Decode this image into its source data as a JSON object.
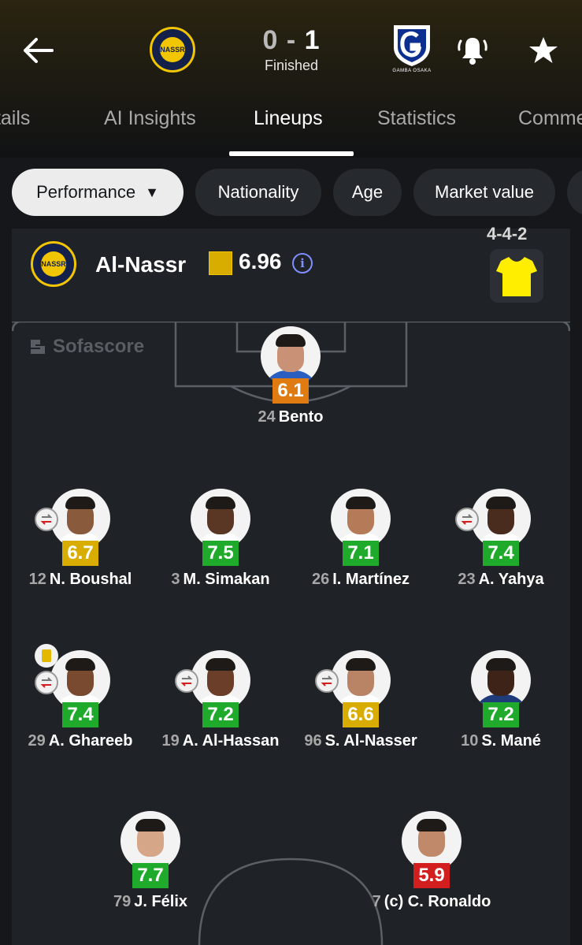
{
  "header": {
    "score_home": "0",
    "score_sep": "-",
    "score_away": "1",
    "status": "Finished",
    "home_logo_text": "NASSR",
    "away_logo_text": "GAMBA OSAKA"
  },
  "tabs": [
    {
      "label": "Details"
    },
    {
      "label": "AI Insights"
    },
    {
      "label": "Lineups",
      "active": true
    },
    {
      "label": "Statistics"
    },
    {
      "label": "Comments"
    }
  ],
  "filters": [
    {
      "label": "Performance",
      "active": true
    },
    {
      "label": "Nationality"
    },
    {
      "label": "Age"
    },
    {
      "label": "Market value"
    }
  ],
  "team": {
    "name": "Al-Nassr",
    "rating": "6.96",
    "formation": "4-4-2",
    "kit_color": "#ffee00"
  },
  "watermark": "Sofascore",
  "colors": {
    "rating_orange": "#e07b12",
    "rating_yellow": "#d8ad00",
    "rating_green": "#1faa2c",
    "rating_red": "#d21e1e"
  },
  "players": [
    {
      "number": "24",
      "name": "Bento",
      "rating": "6.1",
      "rating_color": "orange"
    },
    {
      "number": "12",
      "name": "N. Boushal",
      "rating": "6.7",
      "rating_color": "yellow",
      "sub": true
    },
    {
      "number": "3",
      "name": "M. Simakan",
      "rating": "7.5",
      "rating_color": "green"
    },
    {
      "number": "26",
      "name": "I. Martínez",
      "rating": "7.1",
      "rating_color": "green"
    },
    {
      "number": "23",
      "name": "A. Yahya",
      "rating": "7.4",
      "rating_color": "green",
      "sub": true
    },
    {
      "number": "29",
      "name": "A. Ghareeb",
      "rating": "7.4",
      "rating_color": "green",
      "sub": true,
      "yellow_card": true
    },
    {
      "number": "19",
      "name": "A. Al-Hassan",
      "rating": "7.2",
      "rating_color": "green",
      "sub": true
    },
    {
      "number": "96",
      "name": "S. Al-Nasser",
      "rating": "6.6",
      "rating_color": "yellow",
      "sub": true
    },
    {
      "number": "10",
      "name": "S. Mané",
      "rating": "7.2",
      "rating_color": "green"
    },
    {
      "number": "79",
      "name": "J. Félix",
      "rating": "7.7",
      "rating_color": "green"
    },
    {
      "number": "7",
      "name": "(c) C. Ronaldo",
      "rating": "5.9",
      "rating_color": "red"
    }
  ]
}
